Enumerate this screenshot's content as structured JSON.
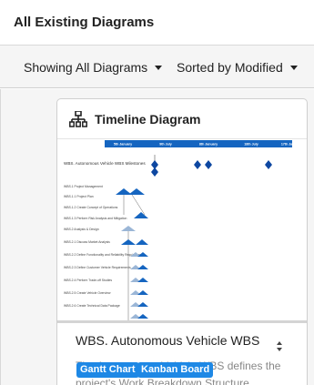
{
  "header": {
    "title": "All Existing Diagrams"
  },
  "toolbar": {
    "showing_label": "Showing All Diagrams",
    "sorted_label": "Sorted by Modified"
  },
  "card": {
    "type_icon": "hierarchy-icon",
    "title": "Timeline Diagram",
    "name": "WBS. Autonomous Vehicle WBS",
    "description": "The Autonomous Vehicle WBS defines the project's Work Breakdown Structure",
    "tags": [
      "Gantt Chart",
      "Kanban Board"
    ],
    "thumbnail": {
      "timeline_headers": [
        "5th January",
        "9th July",
        "8th January",
        "18th July",
        "17th January"
      ],
      "root_label": "WBS. Autonomous Vehicle WBS Milestones",
      "rows": [
        "WBS.1 Project Management",
        "WBS.1.1 Project Plan",
        "WBS.1.2 Create Concept of Operations",
        "WBS.1.3 Perform Risk Analysis and Mitigation",
        "WBS.2 Analysis & Design",
        "WBS.2.1 Discuss Market Analysis",
        "WBS.2.2 Define Functionality and Reliability Requirements",
        "WBS.2.3 Define Customer Vehicle Requirements",
        "WBS.2.4 Perform Trade-off Studies",
        "WBS.2.5 Create Vehicle Overview",
        "WBS.2.6 Create Technical Data Package"
      ]
    }
  },
  "colors": {
    "accent_blue": "#1e88e5",
    "timeline_header": "#1565c0",
    "milestone": "#0d47a1"
  }
}
